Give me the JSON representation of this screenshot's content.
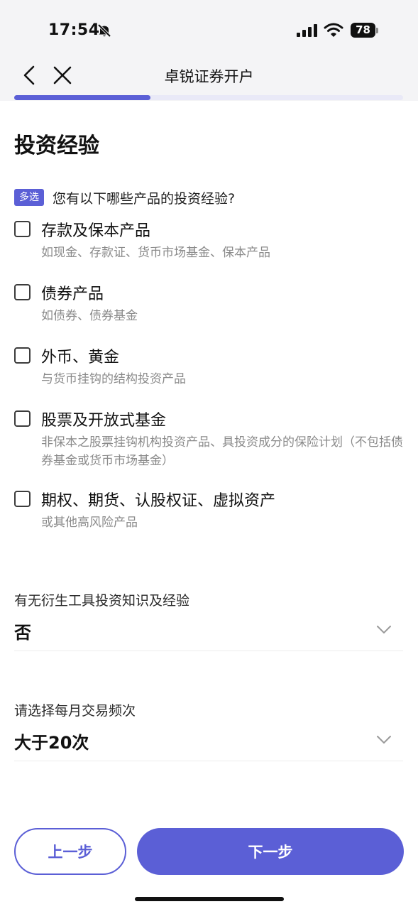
{
  "status_bar": {
    "time": "17:54",
    "battery": "78"
  },
  "nav": {
    "title": "卓锐证券开户",
    "progress": 0.35
  },
  "page_title": "投资经验",
  "question": {
    "badge": "多选",
    "text": "您有以下哪些产品的投资经验?"
  },
  "options": [
    {
      "label": "存款及保本产品",
      "desc": "如现金、存款证、货币市场基金、保本产品",
      "checked": false
    },
    {
      "label": "债券产品",
      "desc": "如债券、债券基金",
      "checked": false
    },
    {
      "label": "外币、黄金",
      "desc": "与货币挂钩的结构投资产品",
      "checked": false
    },
    {
      "label": "股票及开放式基金",
      "desc": "非保本之股票挂钩机构投资产品、具投资成分的保险计划（不包括债券基金或货币市场基金）",
      "checked": false
    },
    {
      "label": "期权、期货、认股权证、虚拟资产",
      "desc": "或其他高风险产品",
      "checked": false
    }
  ],
  "derivatives": {
    "label": "有无衍生工具投资知识及经验",
    "value": "否"
  },
  "trade_frequency": {
    "label": "请选择每月交易频次",
    "value": "大于20次"
  },
  "buttons": {
    "prev": "上一步",
    "next": "下一步"
  },
  "colors": {
    "accent": "#5b5fd6",
    "progress_track": "#e9e9f7",
    "muted_text": "#8a8a8a"
  },
  "icons": {
    "back": "chevron-left-icon",
    "close": "close-icon",
    "dropdown": "chevron-down-icon",
    "mute": "bell-off-icon"
  }
}
